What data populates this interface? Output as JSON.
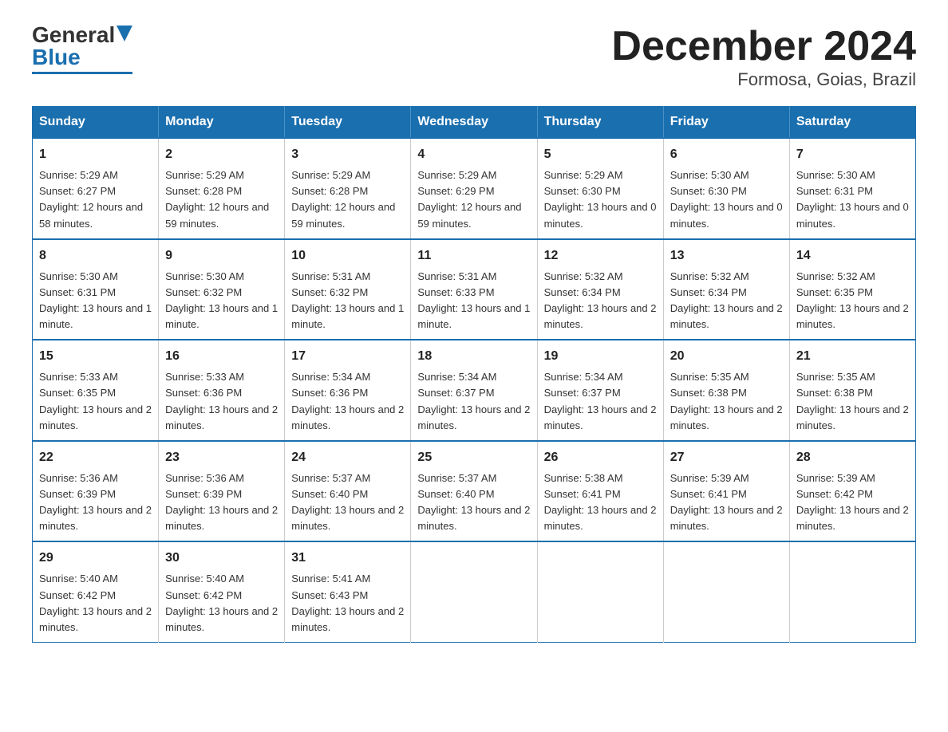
{
  "logo": {
    "general": "General",
    "blue": "Blue"
  },
  "title": "December 2024",
  "subtitle": "Formosa, Goias, Brazil",
  "days_of_week": [
    "Sunday",
    "Monday",
    "Tuesday",
    "Wednesday",
    "Thursday",
    "Friday",
    "Saturday"
  ],
  "weeks": [
    [
      {
        "day": "1",
        "sunrise": "5:29 AM",
        "sunset": "6:27 PM",
        "daylight": "12 hours and 58 minutes."
      },
      {
        "day": "2",
        "sunrise": "5:29 AM",
        "sunset": "6:28 PM",
        "daylight": "12 hours and 59 minutes."
      },
      {
        "day": "3",
        "sunrise": "5:29 AM",
        "sunset": "6:28 PM",
        "daylight": "12 hours and 59 minutes."
      },
      {
        "day": "4",
        "sunrise": "5:29 AM",
        "sunset": "6:29 PM",
        "daylight": "12 hours and 59 minutes."
      },
      {
        "day": "5",
        "sunrise": "5:29 AM",
        "sunset": "6:30 PM",
        "daylight": "13 hours and 0 minutes."
      },
      {
        "day": "6",
        "sunrise": "5:30 AM",
        "sunset": "6:30 PM",
        "daylight": "13 hours and 0 minutes."
      },
      {
        "day": "7",
        "sunrise": "5:30 AM",
        "sunset": "6:31 PM",
        "daylight": "13 hours and 0 minutes."
      }
    ],
    [
      {
        "day": "8",
        "sunrise": "5:30 AM",
        "sunset": "6:31 PM",
        "daylight": "13 hours and 1 minute."
      },
      {
        "day": "9",
        "sunrise": "5:30 AM",
        "sunset": "6:32 PM",
        "daylight": "13 hours and 1 minute."
      },
      {
        "day": "10",
        "sunrise": "5:31 AM",
        "sunset": "6:32 PM",
        "daylight": "13 hours and 1 minute."
      },
      {
        "day": "11",
        "sunrise": "5:31 AM",
        "sunset": "6:33 PM",
        "daylight": "13 hours and 1 minute."
      },
      {
        "day": "12",
        "sunrise": "5:32 AM",
        "sunset": "6:34 PM",
        "daylight": "13 hours and 2 minutes."
      },
      {
        "day": "13",
        "sunrise": "5:32 AM",
        "sunset": "6:34 PM",
        "daylight": "13 hours and 2 minutes."
      },
      {
        "day": "14",
        "sunrise": "5:32 AM",
        "sunset": "6:35 PM",
        "daylight": "13 hours and 2 minutes."
      }
    ],
    [
      {
        "day": "15",
        "sunrise": "5:33 AM",
        "sunset": "6:35 PM",
        "daylight": "13 hours and 2 minutes."
      },
      {
        "day": "16",
        "sunrise": "5:33 AM",
        "sunset": "6:36 PM",
        "daylight": "13 hours and 2 minutes."
      },
      {
        "day": "17",
        "sunrise": "5:34 AM",
        "sunset": "6:36 PM",
        "daylight": "13 hours and 2 minutes."
      },
      {
        "day": "18",
        "sunrise": "5:34 AM",
        "sunset": "6:37 PM",
        "daylight": "13 hours and 2 minutes."
      },
      {
        "day": "19",
        "sunrise": "5:34 AM",
        "sunset": "6:37 PM",
        "daylight": "13 hours and 2 minutes."
      },
      {
        "day": "20",
        "sunrise": "5:35 AM",
        "sunset": "6:38 PM",
        "daylight": "13 hours and 2 minutes."
      },
      {
        "day": "21",
        "sunrise": "5:35 AM",
        "sunset": "6:38 PM",
        "daylight": "13 hours and 2 minutes."
      }
    ],
    [
      {
        "day": "22",
        "sunrise": "5:36 AM",
        "sunset": "6:39 PM",
        "daylight": "13 hours and 2 minutes."
      },
      {
        "day": "23",
        "sunrise": "5:36 AM",
        "sunset": "6:39 PM",
        "daylight": "13 hours and 2 minutes."
      },
      {
        "day": "24",
        "sunrise": "5:37 AM",
        "sunset": "6:40 PM",
        "daylight": "13 hours and 2 minutes."
      },
      {
        "day": "25",
        "sunrise": "5:37 AM",
        "sunset": "6:40 PM",
        "daylight": "13 hours and 2 minutes."
      },
      {
        "day": "26",
        "sunrise": "5:38 AM",
        "sunset": "6:41 PM",
        "daylight": "13 hours and 2 minutes."
      },
      {
        "day": "27",
        "sunrise": "5:39 AM",
        "sunset": "6:41 PM",
        "daylight": "13 hours and 2 minutes."
      },
      {
        "day": "28",
        "sunrise": "5:39 AM",
        "sunset": "6:42 PM",
        "daylight": "13 hours and 2 minutes."
      }
    ],
    [
      {
        "day": "29",
        "sunrise": "5:40 AM",
        "sunset": "6:42 PM",
        "daylight": "13 hours and 2 minutes."
      },
      {
        "day": "30",
        "sunrise": "5:40 AM",
        "sunset": "6:42 PM",
        "daylight": "13 hours and 2 minutes."
      },
      {
        "day": "31",
        "sunrise": "5:41 AM",
        "sunset": "6:43 PM",
        "daylight": "13 hours and 2 minutes."
      },
      null,
      null,
      null,
      null
    ]
  ],
  "labels": {
    "sunrise": "Sunrise:",
    "sunset": "Sunset:",
    "daylight": "Daylight:"
  }
}
